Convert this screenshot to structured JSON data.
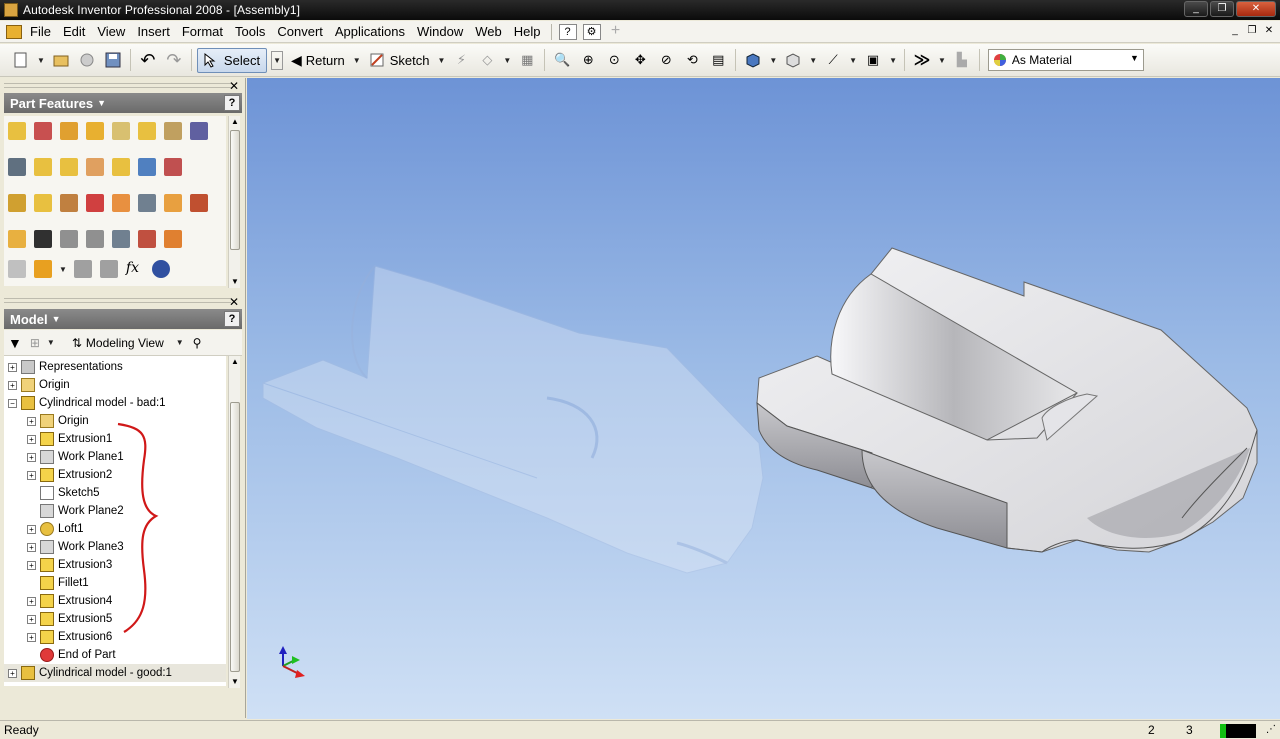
{
  "window": {
    "title": "Autodesk Inventor Professional 2008 - [Assembly1]"
  },
  "menu": {
    "items": [
      "File",
      "Edit",
      "View",
      "Insert",
      "Format",
      "Tools",
      "Convert",
      "Applications",
      "Window",
      "Web",
      "Help"
    ]
  },
  "toolbar": {
    "select_label": "Select",
    "return_label": "Return",
    "sketch_label": "Sketch",
    "appearance_value": "As Material"
  },
  "panels": {
    "features_title": "Part Features",
    "model_title": "Model",
    "modeling_view": "Modeling View"
  },
  "tree": {
    "items": [
      {
        "label": "Representations",
        "icon": "representations-icon"
      },
      {
        "label": "Origin",
        "icon": "folder-icon"
      },
      {
        "label": "Cylindrical model - bad:1",
        "icon": "part-icon"
      },
      {
        "label": "Origin",
        "icon": "folder-icon"
      },
      {
        "label": "Extrusion1",
        "icon": "extrusion-icon"
      },
      {
        "label": "Work Plane1",
        "icon": "work-plane-icon"
      },
      {
        "label": "Extrusion2",
        "icon": "extrusion-icon"
      },
      {
        "label": "Sketch5",
        "icon": "sketch-icon"
      },
      {
        "label": "Work Plane2",
        "icon": "work-plane-icon"
      },
      {
        "label": "Loft1",
        "icon": "loft-icon"
      },
      {
        "label": "Work Plane3",
        "icon": "work-plane-icon"
      },
      {
        "label": "Extrusion3",
        "icon": "extrusion-icon"
      },
      {
        "label": "Fillet1",
        "icon": "fillet-icon"
      },
      {
        "label": "Extrusion4",
        "icon": "extrusion-icon"
      },
      {
        "label": "Extrusion5",
        "icon": "extrusion-icon"
      },
      {
        "label": "Extrusion6",
        "icon": "extrusion-icon"
      },
      {
        "label": "End of Part",
        "icon": "end-of-part-icon"
      },
      {
        "label": "Cylindrical model - good:1",
        "icon": "part-icon"
      }
    ]
  },
  "status": {
    "text": "Ready",
    "num1": "2",
    "num2": "3"
  },
  "colors": {
    "viewport_top": "#6d93d6",
    "viewport_bottom": "#cfe0f5",
    "annotation": "#d01818"
  }
}
